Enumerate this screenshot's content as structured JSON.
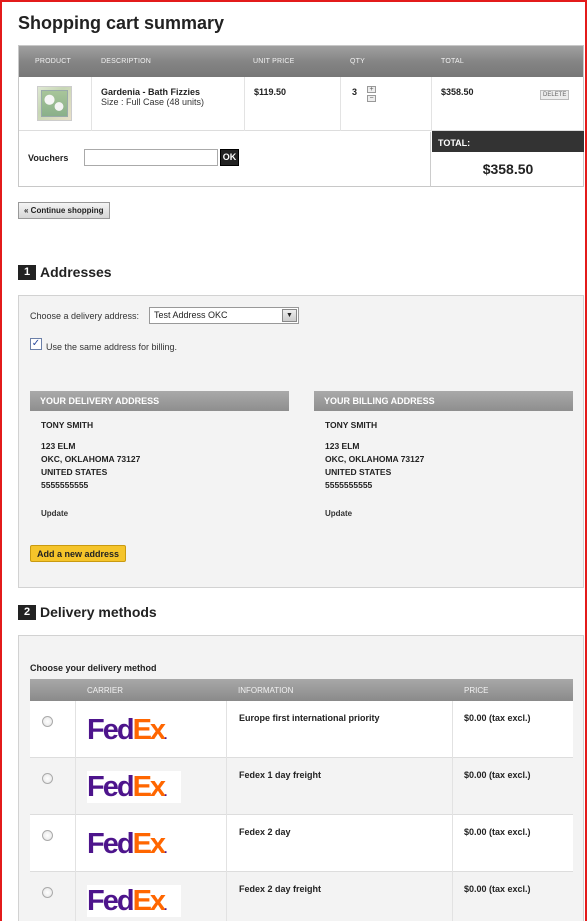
{
  "page": {
    "title": "Shopping cart summary"
  },
  "cart": {
    "headers": [
      "PRODUCT",
      "DESCRIPTION",
      "UNIT PRICE",
      "QTY",
      "TOTAL"
    ],
    "item": {
      "name": "Gardenia - Bath Fizzies",
      "size": "Size : Full Case (48 units)",
      "unit_price": "$119.50",
      "qty": "3",
      "total": "$358.50",
      "delete_label": "DELETE"
    },
    "voucher_label": "Vouchers",
    "voucher_value": "",
    "ok_label": "OK",
    "total_label": "TOTAL:",
    "total_value": "$358.50"
  },
  "continue_label": "« Continue shopping",
  "addresses": {
    "step_number": "1",
    "title": "Addresses",
    "select_label": "Choose a delivery address:",
    "selected_address": "Test Address OKC",
    "same_billing_label": "Use the same address for billing.",
    "same_billing_checked": true,
    "delivery": {
      "heading": "YOUR DELIVERY ADDRESS",
      "name": "TONY SMITH",
      "street": "123 ELM",
      "city": "OKC, OKLAHOMA 73127",
      "country": "UNITED STATES",
      "phone": "5555555555",
      "update_label": "Update"
    },
    "billing": {
      "heading": "YOUR BILLING ADDRESS",
      "name": "TONY SMITH",
      "street": "123 ELM",
      "city": "OKC, OKLAHOMA 73127",
      "country": "UNITED STATES",
      "phone": "5555555555",
      "update_label": "Update"
    },
    "add_address_label": "Add a new address"
  },
  "delivery": {
    "step_number": "2",
    "title": "Delivery methods",
    "choose_label": "Choose your delivery method",
    "headers": [
      "CARRIER",
      "INFORMATION",
      "PRICE"
    ],
    "logo_text": {
      "fe": "Fed",
      "ex": "Ex",
      "dot": "."
    },
    "methods": [
      {
        "info": "Europe first international priority",
        "price": "$0.00 (tax excl.)"
      },
      {
        "info": "Fedex 1 day freight",
        "price": "$0.00 (tax excl.)"
      },
      {
        "info": "Fedex 2 day",
        "price": "$0.00 (tax excl.)"
      },
      {
        "info": "Fedex 2 day freight",
        "price": "$0.00 (tax excl.)"
      }
    ]
  },
  "colors": {
    "frame": "#e31b1b",
    "accent_button": "#f5c42a",
    "fedex_purple": "#4d148c",
    "fedex_orange": "#ff6600"
  }
}
